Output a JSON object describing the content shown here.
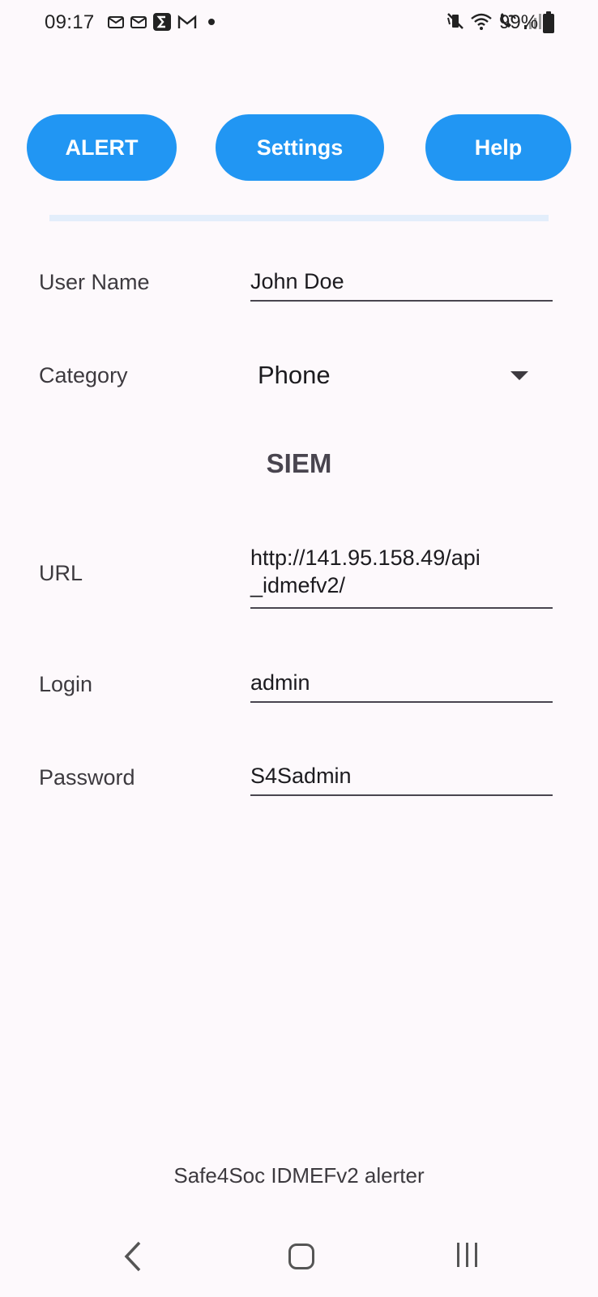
{
  "status_bar": {
    "time": "09:17",
    "battery": "99%",
    "left_icons": [
      "mail-icon",
      "mail-icon",
      "sigma-app-icon",
      "gmail-icon",
      "notification-dot-icon"
    ],
    "right_icons": [
      "mute-vibrate-icon",
      "wifi-icon",
      "wifi-call-icon",
      "signal-icon",
      "battery-icon"
    ]
  },
  "tabs": {
    "alert": "ALERT",
    "settings": "Settings",
    "help": "Help"
  },
  "form": {
    "user_name_label": "User Name",
    "user_name_value": "John Doe",
    "category_label": "Category",
    "category_value": "Phone",
    "siem_title": "SIEM",
    "url_label": "URL",
    "url_value_line1": "http://141.95.158.49/api",
    "url_value_line2": "_idmefv2/",
    "login_label": "Login",
    "login_value": "admin",
    "password_label": "Password",
    "password_value": "S4Sadmin"
  },
  "footer": {
    "text": "Safe4Soc IDMEFv2 alerter"
  },
  "colors": {
    "accent": "#2196f3",
    "background": "#fdf9fc",
    "divider": "#e3eefb"
  }
}
